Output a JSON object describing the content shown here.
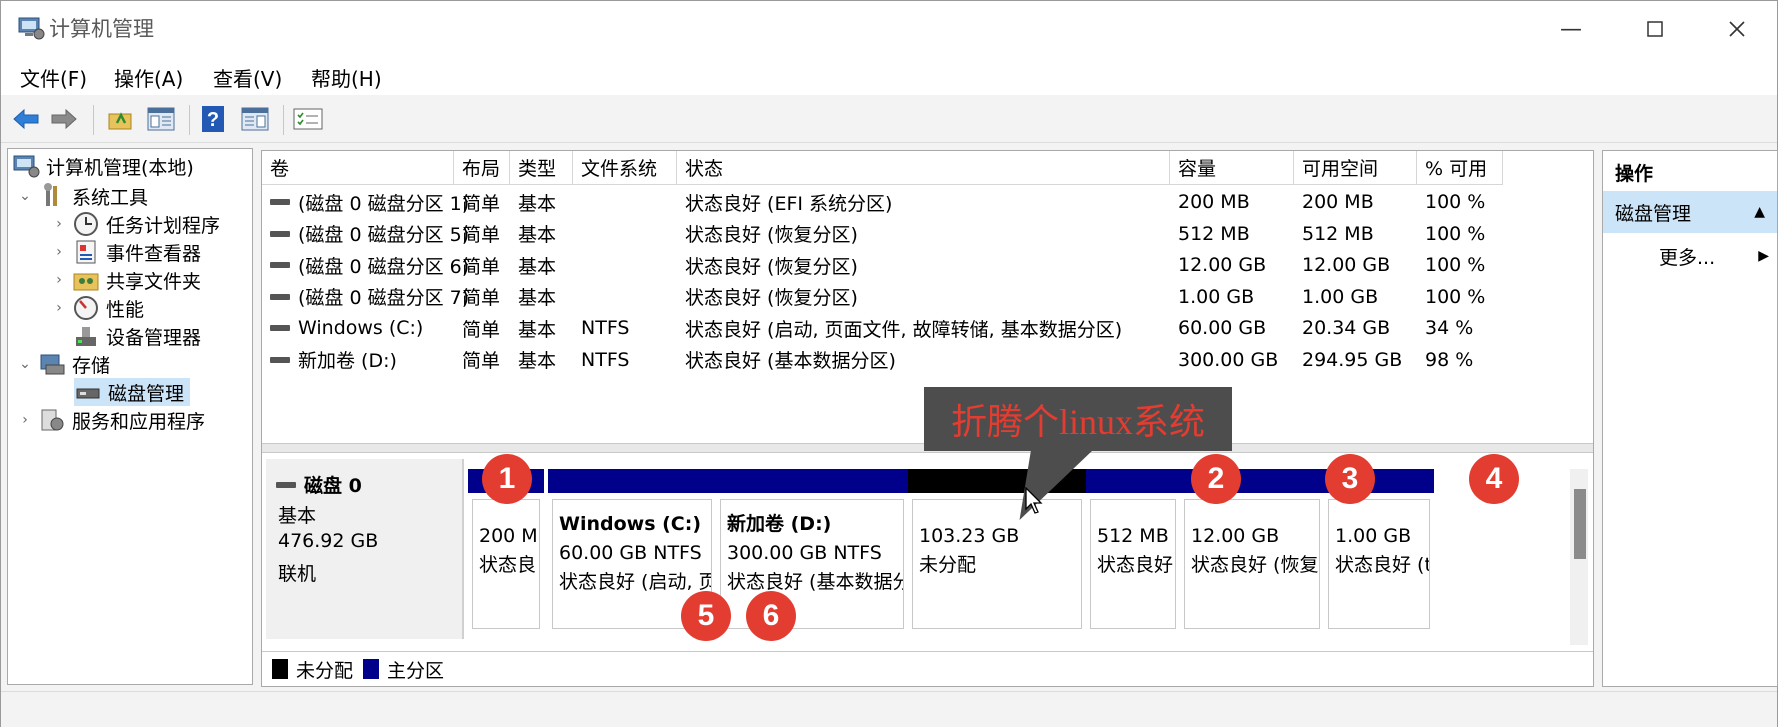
{
  "window": {
    "title": "计算机管理"
  },
  "menu": [
    "文件(F)",
    "操作(A)",
    "查看(V)",
    "帮助(H)"
  ],
  "tree": {
    "root": "计算机管理(本地)",
    "system_tools": "系统工具",
    "task_scheduler": "任务计划程序",
    "event_viewer": "事件查看器",
    "shared_folders": "共享文件夹",
    "performance": "性能",
    "device_manager": "设备管理器",
    "storage": "存储",
    "disk_management": "磁盘管理",
    "services_apps": "服务和应用程序"
  },
  "table": {
    "headers": [
      "卷",
      "布局",
      "类型",
      "文件系统",
      "状态",
      "容量",
      "可用空间",
      "% 可用"
    ],
    "rows": [
      [
        "(磁盘 0 磁盘分区 1)",
        "简单",
        "基本",
        "",
        "状态良好 (EFI 系统分区)",
        "200 MB",
        "200 MB",
        "100 %"
      ],
      [
        "(磁盘 0 磁盘分区 5)",
        "简单",
        "基本",
        "",
        "状态良好 (恢复分区)",
        "512 MB",
        "512 MB",
        "100 %"
      ],
      [
        "(磁盘 0 磁盘分区 6)",
        "简单",
        "基本",
        "",
        "状态良好 (恢复分区)",
        "12.00 GB",
        "12.00 GB",
        "100 %"
      ],
      [
        "(磁盘 0 磁盘分区 7)",
        "简单",
        "基本",
        "",
        "状态良好 (恢复分区)",
        "1.00 GB",
        "1.00 GB",
        "100 %"
      ],
      [
        "Windows (C:)",
        "简单",
        "基本",
        "NTFS",
        "状态良好 (启动, 页面文件, 故障转储, 基本数据分区)",
        "60.00 GB",
        "20.34 GB",
        "34 %"
      ],
      [
        "新加卷 (D:)",
        "简单",
        "基本",
        "NTFS",
        "状态良好 (基本数据分区)",
        "300.00 GB",
        "294.95 GB",
        "98 %"
      ]
    ]
  },
  "disk": {
    "name": "磁盘 0",
    "type": "基本",
    "size": "476.92 GB",
    "status": "联机",
    "partitions": [
      {
        "title": "",
        "line1": "200 M",
        "line2": "状态良",
        "color": "#00008b"
      },
      {
        "title": "Windows  (C:)",
        "line1": "60.00 GB NTFS",
        "line2": "状态良好 (启动, 页",
        "color": "#00008b"
      },
      {
        "title": "新加卷  (D:)",
        "line1": "300.00 GB NTFS",
        "line2": "状态良好 (基本数据分",
        "color": "#00008b"
      },
      {
        "title": "",
        "line1": "103.23 GB",
        "line2": "未分配",
        "color": "#000000"
      },
      {
        "title": "",
        "line1": "512 MB",
        "line2": "状态良好",
        "color": "#00008b"
      },
      {
        "title": "",
        "line1": "12.00 GB",
        "line2": "状态良好 (恢复",
        "color": "#00008b"
      },
      {
        "title": "",
        "line1": "1.00 GB",
        "line2": "状态良好 (t",
        "color": "#00008b"
      }
    ]
  },
  "legend": {
    "unallocated": "未分配",
    "primary": "主分区"
  },
  "actions": {
    "header": "操作",
    "section": "磁盘管理",
    "more": "更多..."
  },
  "annotation": {
    "callout": "折腾个linux系统",
    "badges": [
      "1",
      "2",
      "3",
      "4",
      "5",
      "6"
    ]
  },
  "colors": {
    "primary": "#00008b",
    "unallocated": "#000000",
    "badge": "#e33c31",
    "callout_bg": "#4d4d4d",
    "selection": "#cce4f7"
  }
}
